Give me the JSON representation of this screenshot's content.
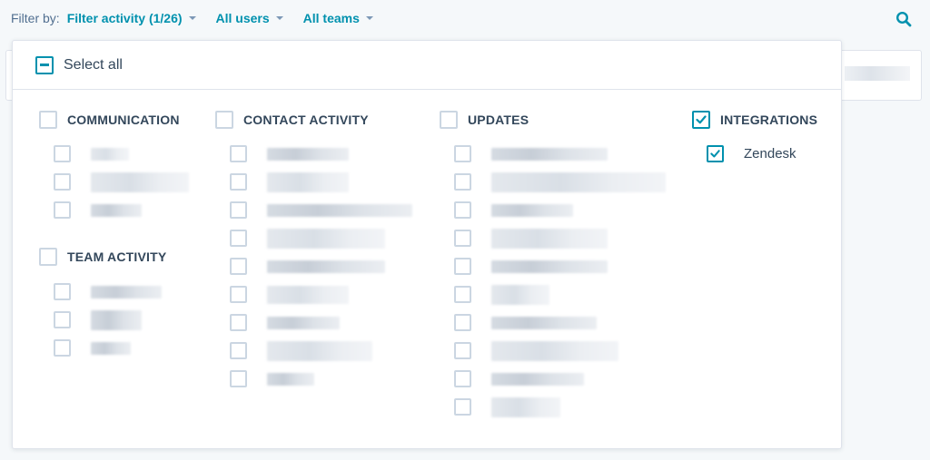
{
  "filter_bar": {
    "label": "Filter by:",
    "activity_filter": "Filter activity (1/26)",
    "users_filter": "All users",
    "teams_filter": "All teams"
  },
  "dropdown": {
    "select_all_label": "Select all",
    "select_all_state": "indeterminate",
    "groups": {
      "communication": {
        "title": "COMMUNICATION",
        "checked": false,
        "item_count": 3
      },
      "team_activity": {
        "title": "TEAM ACTIVITY",
        "checked": false,
        "item_count": 3
      },
      "contact_activity": {
        "title": "CONTACT ACTIVITY",
        "checked": false,
        "item_count": 9
      },
      "updates": {
        "title": "UPDATES",
        "checked": false,
        "item_count": 10
      },
      "integrations": {
        "title": "INTEGRATIONS",
        "checked": true,
        "items": [
          {
            "label": "Zendesk",
            "checked": true
          }
        ]
      }
    }
  },
  "colors": {
    "accent": "#0091ae",
    "text": "#33475b",
    "border": "#cbd6e2"
  }
}
